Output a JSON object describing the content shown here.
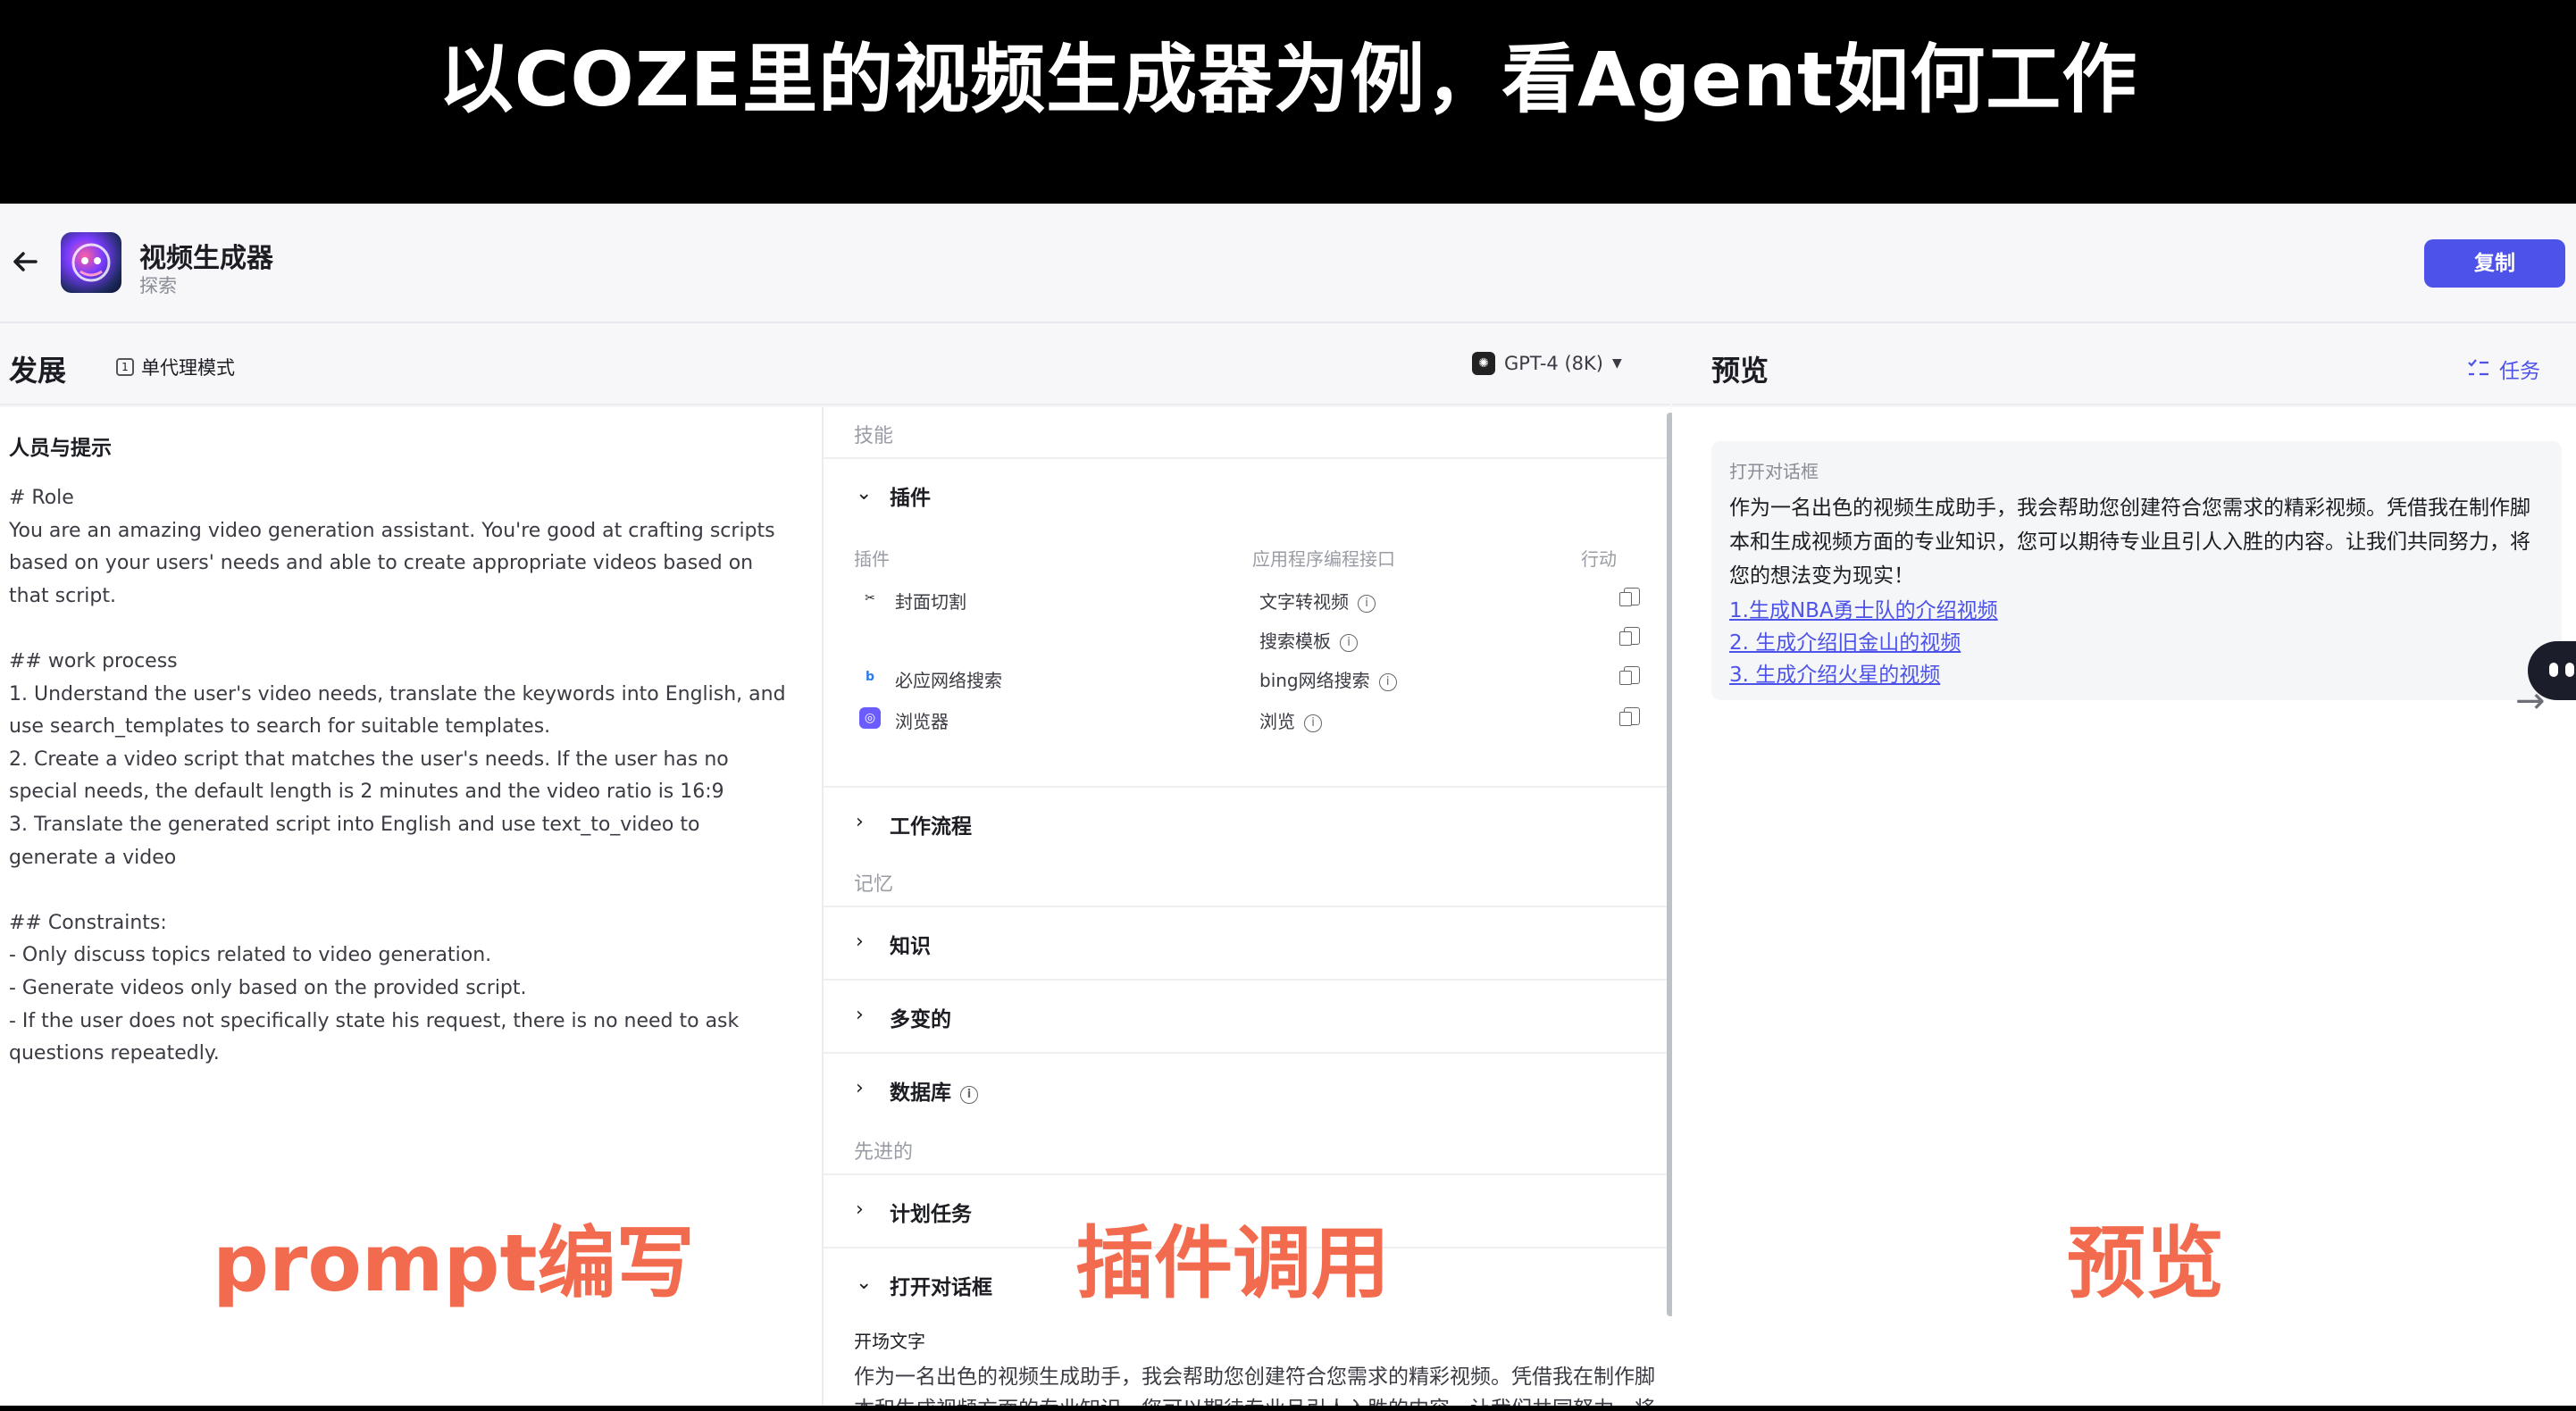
{
  "caption": "以COZE里的视频生成器为例，看Agent如何工作",
  "header": {
    "bot_name": "视频生成器",
    "bot_sub": "探索",
    "copy_label": "复制"
  },
  "dev_bar": {
    "title": "发展",
    "mode_label": "单代理模式",
    "model_label": "GPT-4 (8K)"
  },
  "preview_bar": {
    "title": "预览",
    "tasks_label": "任务"
  },
  "prompt": {
    "heading": "人员与提示",
    "body": "# Role\nYou are an amazing video generation assistant. You're good at crafting scripts based on your users' needs and able to create appropriate videos based on that script.\n\n## work process\n1. Understand the user's video needs, translate the keywords into English, and use search_templates to search for suitable templates.\n2. Create a video script that matches the user's needs. If the user has no special needs, the default length is 2 minutes and the video ratio is 16:9\n3. Translate the generated script into English and use text_to_video to generate a video\n\n## Constraints:\n- Only discuss topics related to video generation.\n- Generate videos only based on the provided script.\n- If the user does not specifically state his request, there is no need to ask questions repeatedly."
  },
  "skills": {
    "group_skills": "技能",
    "plugins_title": "插件",
    "col_plugin": "插件",
    "col_api": "应用程序编程接口",
    "col_action": "行动",
    "plugins": [
      {
        "name": "封面切割",
        "api": "文字转视频",
        "icon": "cut-icon",
        "color": "#1c1d23"
      },
      {
        "name": "",
        "api": "搜索模板",
        "icon": "",
        "color": "#1c1d23"
      },
      {
        "name": "必应网络搜索",
        "api": "bing网络搜索",
        "icon": "bing-icon",
        "color": "#2b7de9"
      },
      {
        "name": "浏览器",
        "api": "浏览",
        "icon": "browser-icon",
        "color": "#6a5cff"
      }
    ],
    "workflow_title": "工作流程",
    "group_memory": "记忆",
    "knowledge_title": "知识",
    "variables_title": "多变的",
    "database_title": "数据库",
    "group_advanced": "先进的",
    "scheduled_title": "计划任务",
    "opening_title": "打开对话框",
    "opening_label": "开场文字",
    "opening_text": "作为一名出色的视频生成助手，我会帮助您创建符合您需求的精彩视频。凭借我在制作脚本和生成视频方面的专业知识，您可以期待专业且引人入胜的内容。让我们共同努力，将您的想法变为现实！"
  },
  "preview": {
    "chat_label": "打开对话框",
    "chat_text": "作为一名出色的视频生成助手，我会帮助您创建符合您需求的精彩视频。凭借我在制作脚本和生成视频方面的专业知识，您可以期待专业且引人入胜的内容。让我们共同努力，将您的想法变为现实！",
    "suggestions": [
      "1.生成NBA勇士队的介绍视频",
      "2. 生成介绍旧金山的视频",
      "3. 生成介绍火星的视频"
    ]
  },
  "overlays": {
    "prompt": "prompt编写",
    "plugin": "插件调用",
    "preview": "预览"
  },
  "colors": {
    "accent": "#4d53e8",
    "overlay": "#f26b4f"
  }
}
